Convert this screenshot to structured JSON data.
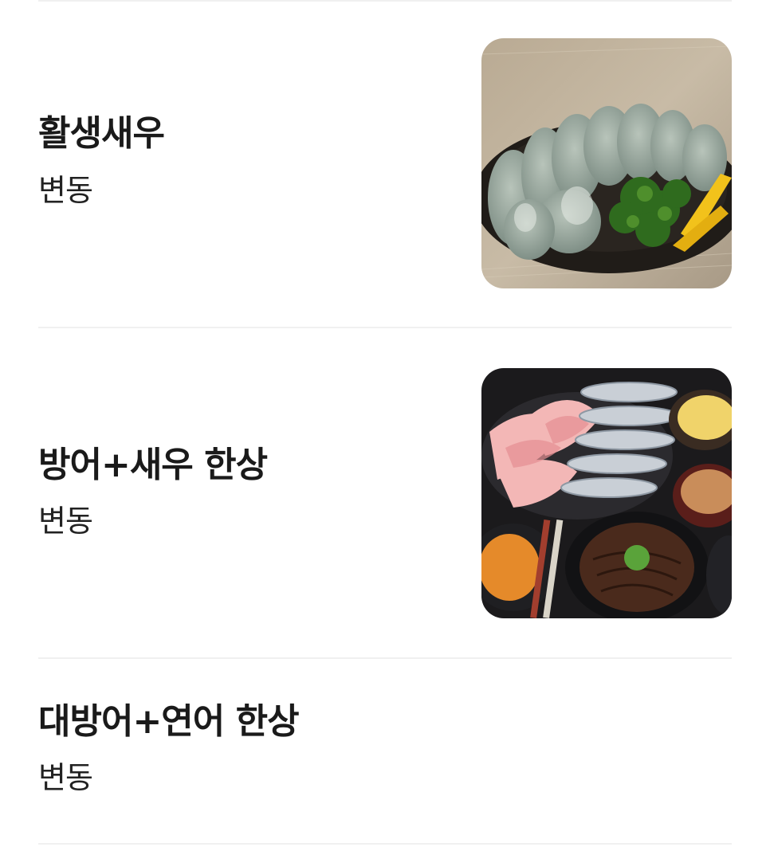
{
  "menu": {
    "items": [
      {
        "name": "활생새우",
        "price": "변동",
        "image": "shrimp-sashimi-photo"
      },
      {
        "name": "방어+새우 한상",
        "price": "변동",
        "image": "yellowtail-shrimp-set-photo"
      },
      {
        "name": "대방어+연어 한상",
        "price": "변동"
      }
    ]
  }
}
